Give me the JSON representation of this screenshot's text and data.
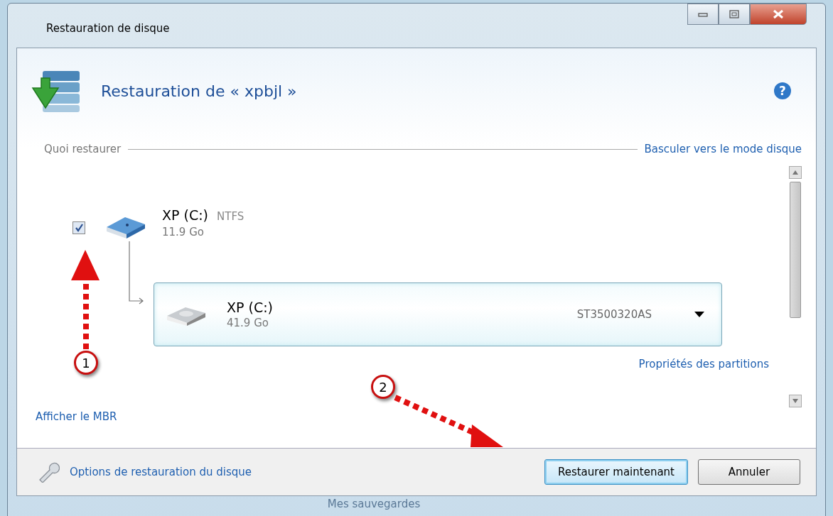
{
  "window": {
    "title": "Restauration de disque"
  },
  "header": {
    "title": "Restauration de « xpbjl »",
    "help": "?"
  },
  "section": {
    "label": "Quoi restaurer",
    "link": "Basculer vers le mode disque"
  },
  "source": {
    "checked": true,
    "name": "XP (C:)",
    "filesystem": "NTFS",
    "size": "11.9 Go"
  },
  "target": {
    "name": "XP (C:)",
    "size": "41.9 Go",
    "disk": "ST3500320AS"
  },
  "partition_link": "Propriétés des partitions",
  "mbr_link": "Afficher le MBR",
  "footer": {
    "options_link": "Options de restauration du disque",
    "buttons": [
      {
        "label": "Restaurer maintenant",
        "default": true
      },
      {
        "label": "Annuler",
        "default": false
      }
    ]
  },
  "annotations": [
    {
      "label": "1"
    },
    {
      "label": "2"
    }
  ],
  "background_text": "Mes sauvegardes"
}
